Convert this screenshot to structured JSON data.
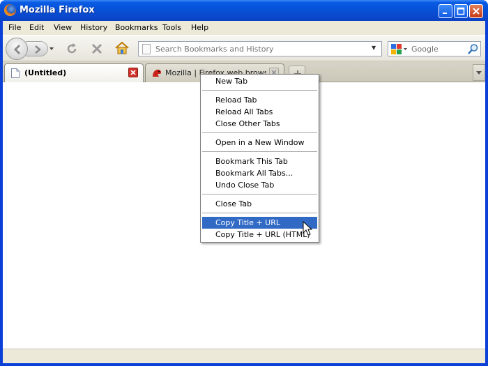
{
  "window": {
    "title": "Mozilla Firefox"
  },
  "menubar": [
    "File",
    "Edit",
    "View",
    "History",
    "Bookmarks",
    "Tools",
    "Help"
  ],
  "navbar": {
    "url_placeholder": "Search Bookmarks and History",
    "search_placeholder": "Google"
  },
  "tabs": [
    {
      "title": "(Untitled)",
      "active": true
    },
    {
      "title": "Mozilla | Firefox web browser",
      "active": false
    }
  ],
  "context_menu": {
    "items": [
      "New Tab",
      "Reload Tab",
      "Reload All Tabs",
      "Close Other Tabs",
      "Open in a New Window",
      "Bookmark This Tab",
      "Bookmark All Tabs...",
      "Undo Close Tab",
      "Close Tab",
      "Copy Title + URL",
      "Copy Title + URL (HTML)"
    ],
    "highlighted": "Copy Title + URL"
  },
  "colors": {
    "titlebar": "#0553d8",
    "menu_highlight": "#316ac5",
    "chrome": "#ece9d8"
  }
}
